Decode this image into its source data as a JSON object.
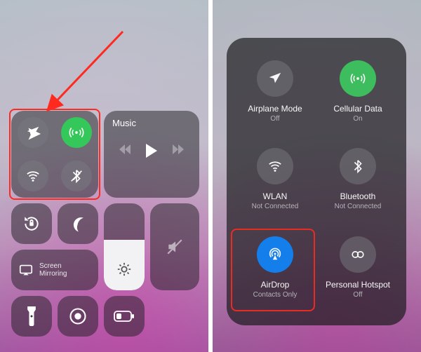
{
  "left": {
    "music_title": "Music",
    "screen_mirroring_label": "Screen\nMirroring"
  },
  "right": {
    "airplane": {
      "title": "Airplane Mode",
      "sub": "Off"
    },
    "cellular": {
      "title": "Cellular Data",
      "sub": "On"
    },
    "wlan": {
      "title": "WLAN",
      "sub": "Not Connected"
    },
    "bluetooth": {
      "title": "Bluetooth",
      "sub": "Not Connected"
    },
    "airdrop": {
      "title": "AirDrop",
      "sub": "Contacts Only"
    },
    "hotspot": {
      "title": "Personal Hotspot",
      "sub": "Off"
    }
  }
}
